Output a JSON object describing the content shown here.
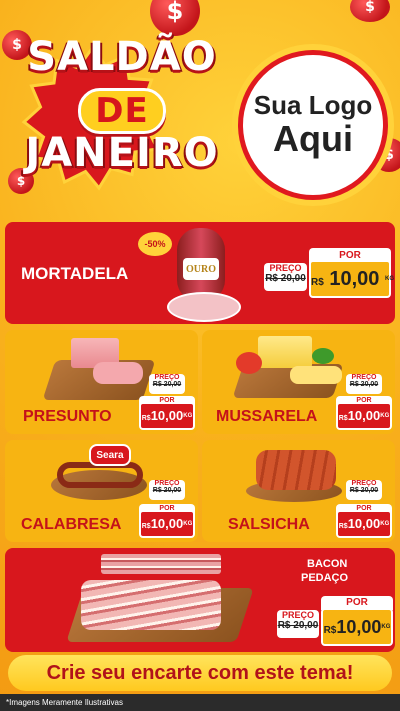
{
  "header": {
    "title_line1": "SALDÃO",
    "title_line2": "DE",
    "title_line3": "JANEIRO",
    "logo_line1": "Sua Logo",
    "logo_line2": "Aqui"
  },
  "labels": {
    "preco": "PREÇO",
    "por": "POR",
    "currency": "R$",
    "unit": "KG"
  },
  "products": {
    "mortadela": {
      "name": "MORTADELA",
      "old_price": "R$ 20,00",
      "new_price": "10,00",
      "badge": "-50%",
      "brand": "OURO"
    },
    "presunto": {
      "name": "PRESUNTO",
      "old_price": "R$ 20,00",
      "new_price": "10,00"
    },
    "mussarela": {
      "name": "MUSSARELA",
      "old_price": "R$ 20,00",
      "new_price": "10,00"
    },
    "calabresa": {
      "name": "CALABRESA",
      "old_price": "R$ 20,00",
      "new_price": "10,00",
      "brand": "Seara"
    },
    "salsicha": {
      "name": "SALSICHA",
      "old_price": "R$ 20,00",
      "new_price": "10,00"
    },
    "bacon": {
      "name_line1": "BACON",
      "name_line2": "PEDAÇO",
      "old_price": "R$ 20,00",
      "new_price": "10,00"
    }
  },
  "footer": {
    "cta": "Crie seu encarte com este tema!",
    "disclaimer": "*Imagens Meramente Ilustrativas"
  },
  "colors": {
    "red": "#d8171d",
    "yellow": "#f7b412",
    "dark": "#2b2b2b"
  }
}
